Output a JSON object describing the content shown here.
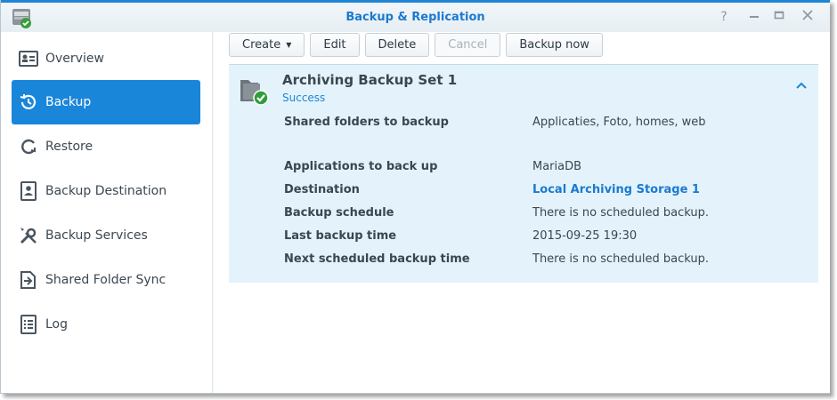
{
  "window": {
    "title": "Backup & Replication"
  },
  "sidebar": {
    "items": [
      {
        "label": "Overview",
        "icon": "overview-icon"
      },
      {
        "label": "Backup",
        "icon": "backup-clock-icon",
        "active": true
      },
      {
        "label": "Restore",
        "icon": "restore-icon"
      },
      {
        "label": "Backup Destination",
        "icon": "destination-icon"
      },
      {
        "label": "Backup Services",
        "icon": "wrench-screwdriver-icon"
      },
      {
        "label": "Shared Folder Sync",
        "icon": "folder-sync-icon"
      },
      {
        "label": "Log",
        "icon": "log-icon"
      }
    ]
  },
  "toolbar": {
    "create": "Create",
    "edit": "Edit",
    "delete": "Delete",
    "cancel": "Cancel",
    "backup_now": "Backup now"
  },
  "task": {
    "title": "Archiving Backup Set 1",
    "status": "Success",
    "details": [
      {
        "key": "Shared folders to backup",
        "value": "Applicaties, Foto, homes, web"
      },
      {
        "key": "Applications to back up",
        "value": "MariaDB"
      },
      {
        "key": "Destination",
        "value": "Local Archiving Storage 1",
        "link": true
      },
      {
        "key": "Backup schedule",
        "value": "There is no scheduled backup."
      },
      {
        "key": "Last backup time",
        "value": "2015-09-25 19:30"
      },
      {
        "key": "Next scheduled backup time",
        "value": "There is no scheduled backup."
      }
    ]
  },
  "colors": {
    "accent": "#1a86da",
    "panel_bg": "#e4f3fb",
    "success": "#2e9e3a"
  }
}
